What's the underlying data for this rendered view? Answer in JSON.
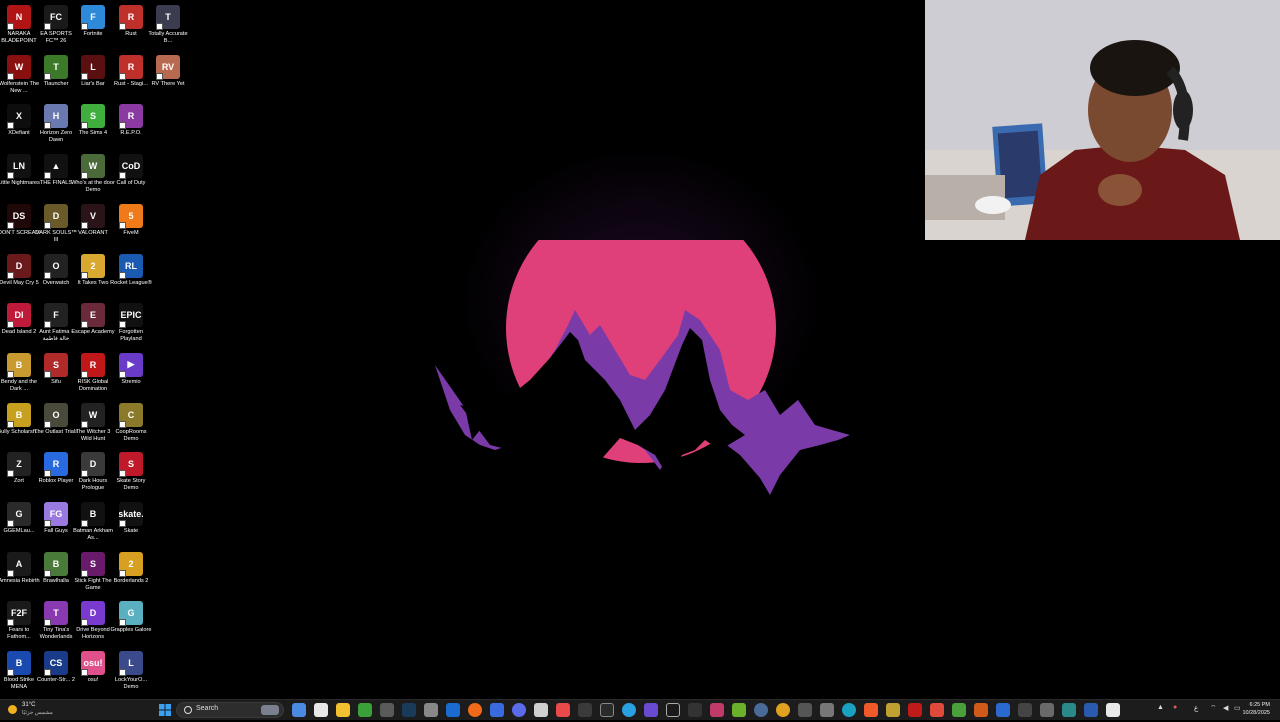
{
  "desktop": {
    "icons": [
      {
        "label": "NARAKA BLADEPOINT",
        "color": "#b01414",
        "glyph": "N",
        "icon": "naraka-icon"
      },
      {
        "label": "EA SPORTS FC™ 26",
        "color": "#1a1a1a",
        "glyph": "FC",
        "icon": "ea-fc-icon"
      },
      {
        "label": "Fortnite",
        "color": "#2e8ad8",
        "glyph": "F",
        "icon": "fortnite-icon"
      },
      {
        "label": "Rust",
        "color": "#c0302a",
        "glyph": "R",
        "icon": "rust-icon"
      },
      {
        "label": "Totally Accurate B...",
        "color": "#3c3c50",
        "glyph": "T",
        "icon": "tabs-icon"
      },
      {
        "label": "Wolfenstein The New ...",
        "color": "#8a1010",
        "glyph": "W",
        "icon": "wolfenstein-icon"
      },
      {
        "label": "Tlauncher",
        "color": "#3c7a2a",
        "glyph": "T",
        "icon": "tlauncher-icon"
      },
      {
        "label": "Liar's Bar",
        "color": "#5a1010",
        "glyph": "L",
        "icon": "liars-bar-icon"
      },
      {
        "label": "Rust - Stagi...",
        "color": "#c0302a",
        "glyph": "R",
        "icon": "rust-staging-icon"
      },
      {
        "label": "RV There Yet",
        "color": "#b86a50",
        "glyph": "RV",
        "icon": "rv-there-yet-icon"
      },
      {
        "label": "XDefiant",
        "color": "#0d0d0d",
        "glyph": "X",
        "icon": "xdefiant-icon"
      },
      {
        "label": "Horizon Zero Dawn",
        "color": "#6a7ab0",
        "glyph": "H",
        "icon": "horizon-icon"
      },
      {
        "label": "The Sims 4",
        "color": "#3fae3f",
        "glyph": "S",
        "icon": "sims-icon"
      },
      {
        "label": "R.E.P.O.",
        "color": "#8a3aa0",
        "glyph": "R",
        "icon": "repo-icon"
      },
      {
        "label": "Little Nightmares",
        "color": "#111",
        "glyph": "LN",
        "icon": "little-nightmares-icon"
      },
      {
        "label": "THE FINALS",
        "color": "#111",
        "glyph": "▲",
        "icon": "the-finals-icon"
      },
      {
        "label": "Who's at the door Demo",
        "color": "#4a6a3a",
        "glyph": "W",
        "icon": "whos-at-door-icon"
      },
      {
        "label": "Call of Duty",
        "color": "#111",
        "glyph": "CoD",
        "icon": "call-of-duty-icon"
      },
      {
        "label": "DON'T SCREAM",
        "color": "#200808",
        "glyph": "DS",
        "icon": "dont-scream-icon"
      },
      {
        "label": "DARK SOULS™ III",
        "color": "#6a5a2a",
        "glyph": "D",
        "icon": "dark-souls-icon"
      },
      {
        "label": "VALORANT",
        "color": "#2a1418",
        "glyph": "V",
        "icon": "valorant-icon"
      },
      {
        "label": "FiveM",
        "color": "#f07a1a",
        "glyph": "5",
        "icon": "fivem-icon"
      },
      {
        "label": "Devil May Cry 5",
        "color": "#6a1a1a",
        "glyph": "D",
        "icon": "devil-may-cry-icon"
      },
      {
        "label": "Overwatch",
        "color": "#222",
        "glyph": "O",
        "icon": "overwatch-icon"
      },
      {
        "label": "It Takes Two",
        "color": "#d8a830",
        "glyph": "2",
        "icon": "it-takes-two-icon"
      },
      {
        "label": "Rocket League®",
        "color": "#1a5ab0",
        "glyph": "RL",
        "icon": "rocket-league-icon"
      },
      {
        "label": "Dead Island 2",
        "color": "#c01a3a",
        "glyph": "DI",
        "icon": "dead-island-icon"
      },
      {
        "label": "Aunt Fatima - خالة فاطمة",
        "color": "#222",
        "glyph": "F",
        "icon": "aunt-fatima-icon"
      },
      {
        "label": "Escape Academy",
        "color": "#6a2a3a",
        "glyph": "E",
        "icon": "escape-academy-icon"
      },
      {
        "label": "Forgotten Playland",
        "color": "#111",
        "glyph": "EPIC",
        "icon": "epic-games-icon"
      },
      {
        "label": "Bendy and the Dark ...",
        "color": "#c89a30",
        "glyph": "B",
        "icon": "bendy-icon"
      },
      {
        "label": "Sifu",
        "color": "#b02a2a",
        "glyph": "S",
        "icon": "sifu-icon"
      },
      {
        "label": "RISK Global Domination",
        "color": "#c01818",
        "glyph": "R",
        "icon": "risk-icon"
      },
      {
        "label": "Stremio",
        "color": "#6a3ac8",
        "glyph": "▶",
        "icon": "stremio-icon"
      },
      {
        "label": "Bully Scholarsh...",
        "color": "#c8a020",
        "glyph": "B",
        "icon": "bully-icon"
      },
      {
        "label": "The Outlast Trials",
        "color": "#4a4a3a",
        "glyph": "O",
        "icon": "outlast-icon"
      },
      {
        "label": "The Witcher 3 Wild Hunt",
        "color": "#222",
        "glyph": "W",
        "icon": "witcher-icon"
      },
      {
        "label": "CoopRooms Demo",
        "color": "#8a7a2a",
        "glyph": "C",
        "icon": "cooprooms-icon"
      },
      {
        "label": "Zort",
        "color": "#222",
        "glyph": "Z",
        "icon": "zort-icon"
      },
      {
        "label": "Roblox Player",
        "color": "#2a6ae0",
        "glyph": "R",
        "icon": "roblox-icon"
      },
      {
        "label": "Dark Hours Prologue",
        "color": "#3a3a3a",
        "glyph": "D",
        "icon": "dark-hours-icon"
      },
      {
        "label": "Skate Story Demo",
        "color": "#c01a2a",
        "glyph": "S",
        "icon": "skate-story-icon"
      },
      {
        "label": "GGEMLau...",
        "color": "#2a2a2a",
        "glyph": "G",
        "icon": "ggem-launcher-icon"
      },
      {
        "label": "Fall Guys",
        "color": "#9a7ae0",
        "glyph": "FG",
        "icon": "fall-guys-icon"
      },
      {
        "label": "Batman Arkham As...",
        "color": "#111",
        "glyph": "B",
        "icon": "batman-icon"
      },
      {
        "label": "Skate",
        "color": "#111",
        "glyph": "skate.",
        "icon": "skate-icon"
      },
      {
        "label": "Amnesia Rebirth",
        "color": "#1a1a1a",
        "glyph": "A",
        "icon": "amnesia-icon"
      },
      {
        "label": "Brawlhalla",
        "color": "#4a7a3a",
        "glyph": "B",
        "icon": "brawlhalla-icon"
      },
      {
        "label": "Stick Fight The Game",
        "color": "#6a1a6a",
        "glyph": "S",
        "icon": "stick-fight-icon"
      },
      {
        "label": "Borderlands 2",
        "color": "#d8a020",
        "glyph": "2",
        "icon": "borderlands-icon"
      },
      {
        "label": "Fears to Fathom...",
        "color": "#1a1a1a",
        "glyph": "F2F",
        "icon": "fears-to-fathom-icon"
      },
      {
        "label": "Tiny Tina's Wonderlands",
        "color": "#8a3ab0",
        "glyph": "T",
        "icon": "tiny-tina-icon"
      },
      {
        "label": "Drive Beyond Horizons",
        "color": "#7a3ad0",
        "glyph": "D",
        "icon": "drive-beyond-icon"
      },
      {
        "label": "Grapples Galore",
        "color": "#5ab0c0",
        "glyph": "G",
        "icon": "grapples-galore-icon"
      },
      {
        "label": "Blood Strike MENA",
        "color": "#1a4ab0",
        "glyph": "B",
        "icon": "blood-strike-icon"
      },
      {
        "label": "Counter-Str... 2",
        "color": "#1a3a8a",
        "glyph": "CS",
        "icon": "counter-strike-icon"
      },
      {
        "label": "osu!",
        "color": "#e0508a",
        "glyph": "osu!",
        "icon": "osu-icon"
      },
      {
        "label": "LockYourO... Demo",
        "color": "#3a4a8a",
        "glyph": "L",
        "icon": "lockyour-demo-icon"
      }
    ]
  },
  "wallpaper": {
    "sun_color": "#e0407a",
    "mountain_color": "#7a3aa8",
    "shadow_color": "#000000"
  },
  "taskbar": {
    "weather": {
      "temp": "31°C",
      "condition": "مشمس جزئيًا"
    },
    "search_placeholder": "Search",
    "tray_lang": "ع",
    "clock": {
      "time": "6:25 PM",
      "date": "10/28/2025"
    }
  }
}
